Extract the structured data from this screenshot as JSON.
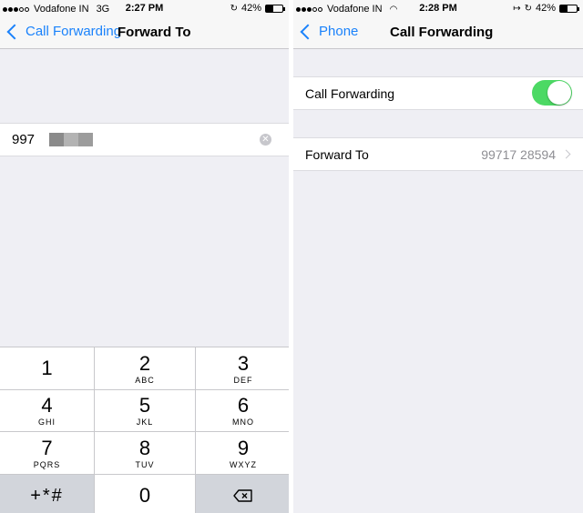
{
  "colors": {
    "accent": "#1a82fb",
    "toggle_on": "#4cd964",
    "background": "#efeff4"
  },
  "left": {
    "status": {
      "carrier": "Vodafone IN",
      "network": "3G",
      "time": "2:27 PM",
      "battery": "42%",
      "battery_level": 0.42
    },
    "nav": {
      "back_label": "Call Forwarding",
      "title": "Forward To"
    },
    "input": {
      "value": "997"
    },
    "keypad": [
      {
        "num": "1",
        "letters": ""
      },
      {
        "num": "2",
        "letters": "ABC"
      },
      {
        "num": "3",
        "letters": "DEF"
      },
      {
        "num": "4",
        "letters": "GHI"
      },
      {
        "num": "5",
        "letters": "JKL"
      },
      {
        "num": "6",
        "letters": "MNO"
      },
      {
        "num": "7",
        "letters": "PQRS"
      },
      {
        "num": "8",
        "letters": "TUV"
      },
      {
        "num": "9",
        "letters": "WXYZ"
      },
      {
        "num": "+*#",
        "letters": ""
      },
      {
        "num": "0",
        "letters": ""
      }
    ]
  },
  "right": {
    "status": {
      "carrier": "Vodafone IN",
      "time": "2:28 PM",
      "battery": "42%",
      "battery_level": 0.42
    },
    "nav": {
      "back_label": "Phone",
      "title": "Call Forwarding"
    },
    "call_forwarding": {
      "label": "Call Forwarding",
      "enabled": true
    },
    "forward_to": {
      "label": "Forward To",
      "value": "99717 28594"
    }
  }
}
